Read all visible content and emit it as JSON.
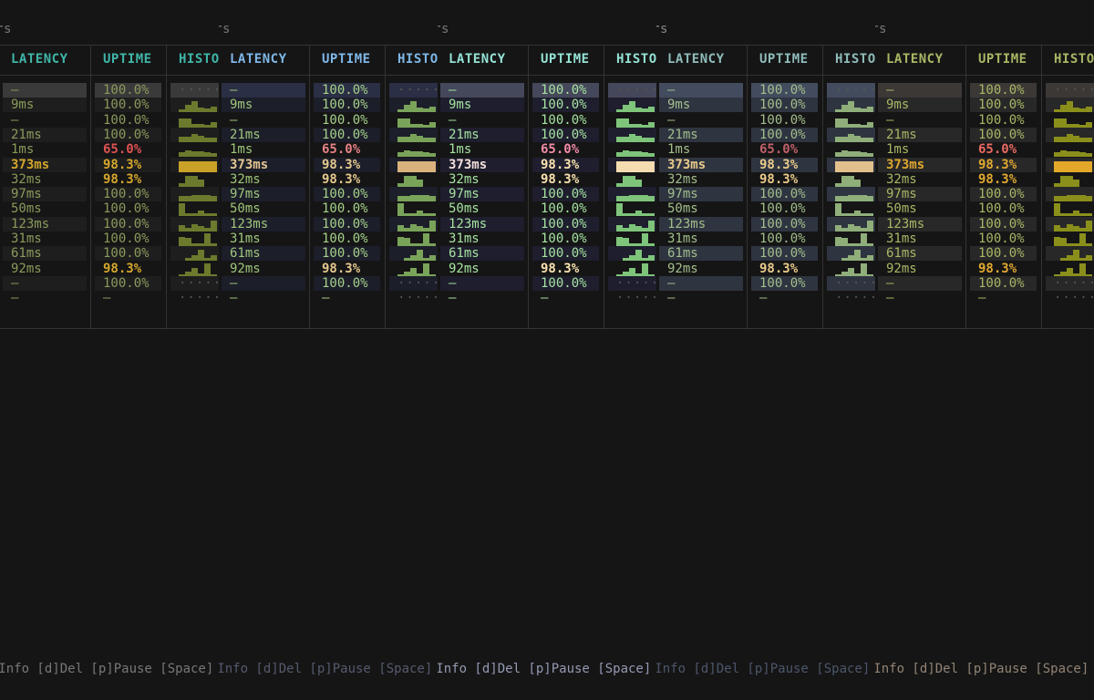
{
  "header_title": "Users",
  "columns": {
    "latency": "LATENCY",
    "uptime": "UPTIME",
    "histo": "HISTORY"
  },
  "footer_text": "[i]Info [d]Del [p]Pause [Space]",
  "rows": [
    {
      "latency": "—",
      "uptime": "100.0%",
      "state": "ok",
      "selected": true,
      "hist": "dots"
    },
    {
      "latency": "9ms",
      "uptime": "100.0%",
      "state": "ok",
      "hist": "h1"
    },
    {
      "latency": "—",
      "uptime": "100.0%",
      "state": "ok",
      "hist": "h2"
    },
    {
      "latency": "21ms",
      "uptime": "100.0%",
      "state": "ok",
      "hist": "h3"
    },
    {
      "latency": "1ms",
      "uptime": "65.0%",
      "state": "bad",
      "hist": "h4"
    },
    {
      "latency": "373ms",
      "uptime": "98.3%",
      "state": "warn",
      "hist": "h5"
    },
    {
      "latency": "32ms",
      "uptime": "98.3%",
      "state": "warn",
      "hist": "h6"
    },
    {
      "latency": "97ms",
      "uptime": "100.0%",
      "state": "ok",
      "hist": "h7"
    },
    {
      "latency": "50ms",
      "uptime": "100.0%",
      "state": "ok",
      "hist": "h8"
    },
    {
      "latency": "123ms",
      "uptime": "100.0%",
      "state": "ok",
      "hist": "h9"
    },
    {
      "latency": "31ms",
      "uptime": "100.0%",
      "state": "ok",
      "hist": "h10"
    },
    {
      "latency": "61ms",
      "uptime": "100.0%",
      "state": "ok",
      "hist": "h11"
    },
    {
      "latency": "92ms",
      "uptime": "98.3%",
      "state": "warn",
      "hist": "h12"
    },
    {
      "latency": "—",
      "uptime": "100.0%",
      "state": "ok",
      "hist": "dots"
    },
    {
      "latency": "—",
      "uptime": "—",
      "state": "none",
      "hist": "dots"
    }
  ],
  "themes": [
    {
      "name": "theme-teal",
      "title": "#777777",
      "hdr": "#3fb6a8",
      "lat": "#8a9a5b",
      "ok": "#8a9a5b",
      "warn": "#d4a72c",
      "bad": "#e05252",
      "lat_hi": "#d4a72c",
      "sel": "#3a3a3a",
      "stripe": "#1e1e1e",
      "bar": "#6b7a2c",
      "bar_hi": "#c9a227",
      "footer": "#777777"
    },
    {
      "name": "theme-blue",
      "title": "#777777",
      "hdr": "#7fb7e8",
      "lat": "#9ec57a",
      "ok": "#a6d189",
      "warn": "#e5c890",
      "bad": "#e78284",
      "lat_hi": "#e5c890",
      "sel": "#2a2f45",
      "stripe": "#1c1e2a",
      "bar": "#7aa35a",
      "bar_hi": "#d9b27c",
      "footer": "#555a6e"
    },
    {
      "name": "theme-mint",
      "title": "#777777",
      "hdr": "#94e2d5",
      "lat": "#a6e3a1",
      "ok": "#a6e3a1",
      "warn": "#f9e2af",
      "bad": "#f38ba8",
      "lat_hi": "#f5e0dc",
      "sel": "#45475a",
      "stripe": "#1e1e2e",
      "bar": "#7ec47a",
      "bar_hi": "#f5dcb0",
      "footer": "#9399b2"
    },
    {
      "name": "theme-slate",
      "title": "#888888",
      "hdr": "#8fbcbb",
      "lat": "#a3be8c",
      "ok": "#a3be8c",
      "warn": "#ebcb8b",
      "bad": "#bf616a",
      "lat_hi": "#ebcb8b",
      "sel": "#434c5e",
      "stripe": "#2e3440",
      "bar": "#8fae7a",
      "bar_hi": "#e2c08d",
      "footer": "#4c566a"
    },
    {
      "name": "theme-olive",
      "title": "#777777",
      "hdr": "#a9b665",
      "lat": "#a9b665",
      "ok": "#a9b665",
      "warn": "#e0a830",
      "bad": "#ea6962",
      "lat_hi": "#e0a830",
      "sel": "#3c3836",
      "stripe": "#282828",
      "bar": "#8a8f1c",
      "bar_hi": "#e3a82a",
      "footer": "#928374"
    }
  ]
}
